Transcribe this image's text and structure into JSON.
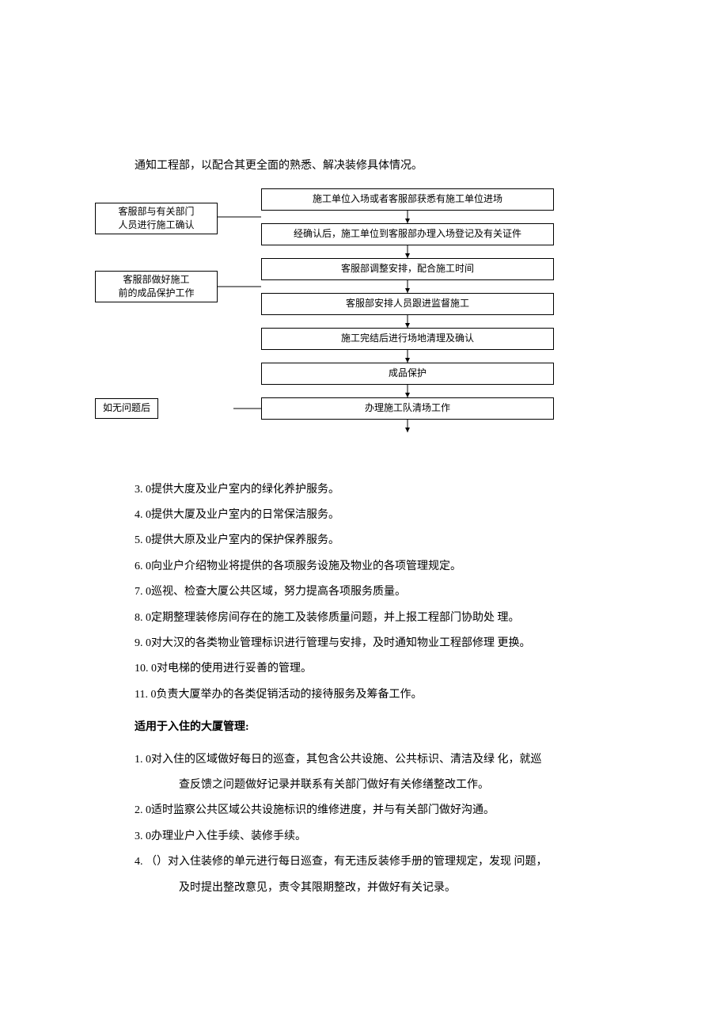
{
  "intro": "通知工程部，以配合其更全面的熟悉、解决装修具体情况。",
  "flowchart": {
    "left_box_1_line1": "客服部与有关部门",
    "left_box_1_line2": "人员进行施工确认",
    "left_box_2_line1": "客服部做好施工",
    "left_box_2_line2": "前的成品保护工作",
    "left_box_3": "如无问题后",
    "right_box_1": "施工单位入场或者客服部获悉有施工单位进场",
    "right_box_2": "经确认后，施工单位到客服部办理入场登记及有关证件",
    "right_box_3": "客服部调整安排，配合施工时间",
    "right_box_4": "客服部安排人员跟进监督施工",
    "right_box_5": "施工完结后进行场地清理及确认",
    "right_box_6": "成品保护",
    "right_box_7": "办理施工队清场工作"
  },
  "list1": [
    "3. 0提供大度及业户室内的绿化养护服务。",
    "4. 0提供大厦及业户室内的日常保洁服务。",
    "5. 0提供大原及业户室内的保护保养服务。",
    "6.  0向业户介绍物业将提供的各项服务设施及物业的各项管理规定。",
    "7. 0巡视、检查大厦公共区域，努力提高各项服务质量。",
    "8. 0定期整理装修房间存在的施工及装修质量问题，并上报工程部门协助处  理。",
    "9. 0对大汉的各类物业管理标识进行管理与安排，及时通知物业工程部修理  更换。",
    "10.   0对电梯的使用进行妥善的管理。",
    "11.   0负责大厦举办的各类促销活动的接待服务及筹备工作。"
  ],
  "section2_title": "适用于入住的大厦管理:",
  "list2": [
    "1. 0对入住的区域做好每日的巡查，其包含公共设施、公共标识、清洁及绿  化，就巡",
    "查反馈之问题做好记录并联系有关部门做好有关修缮整改工作。",
    "2. 0适时监察公共区域公共设施标识的维修进度，并与有关部门做好沟通。",
    "3. 0办理业户入住手续、装修手续。",
    "4. （）对入住装修的单元进行每日巡查，有无违反装修手册的管理规定，发现    问题，",
    "及时提出整改意见，责令其限期整改，并做好有关记录。"
  ]
}
